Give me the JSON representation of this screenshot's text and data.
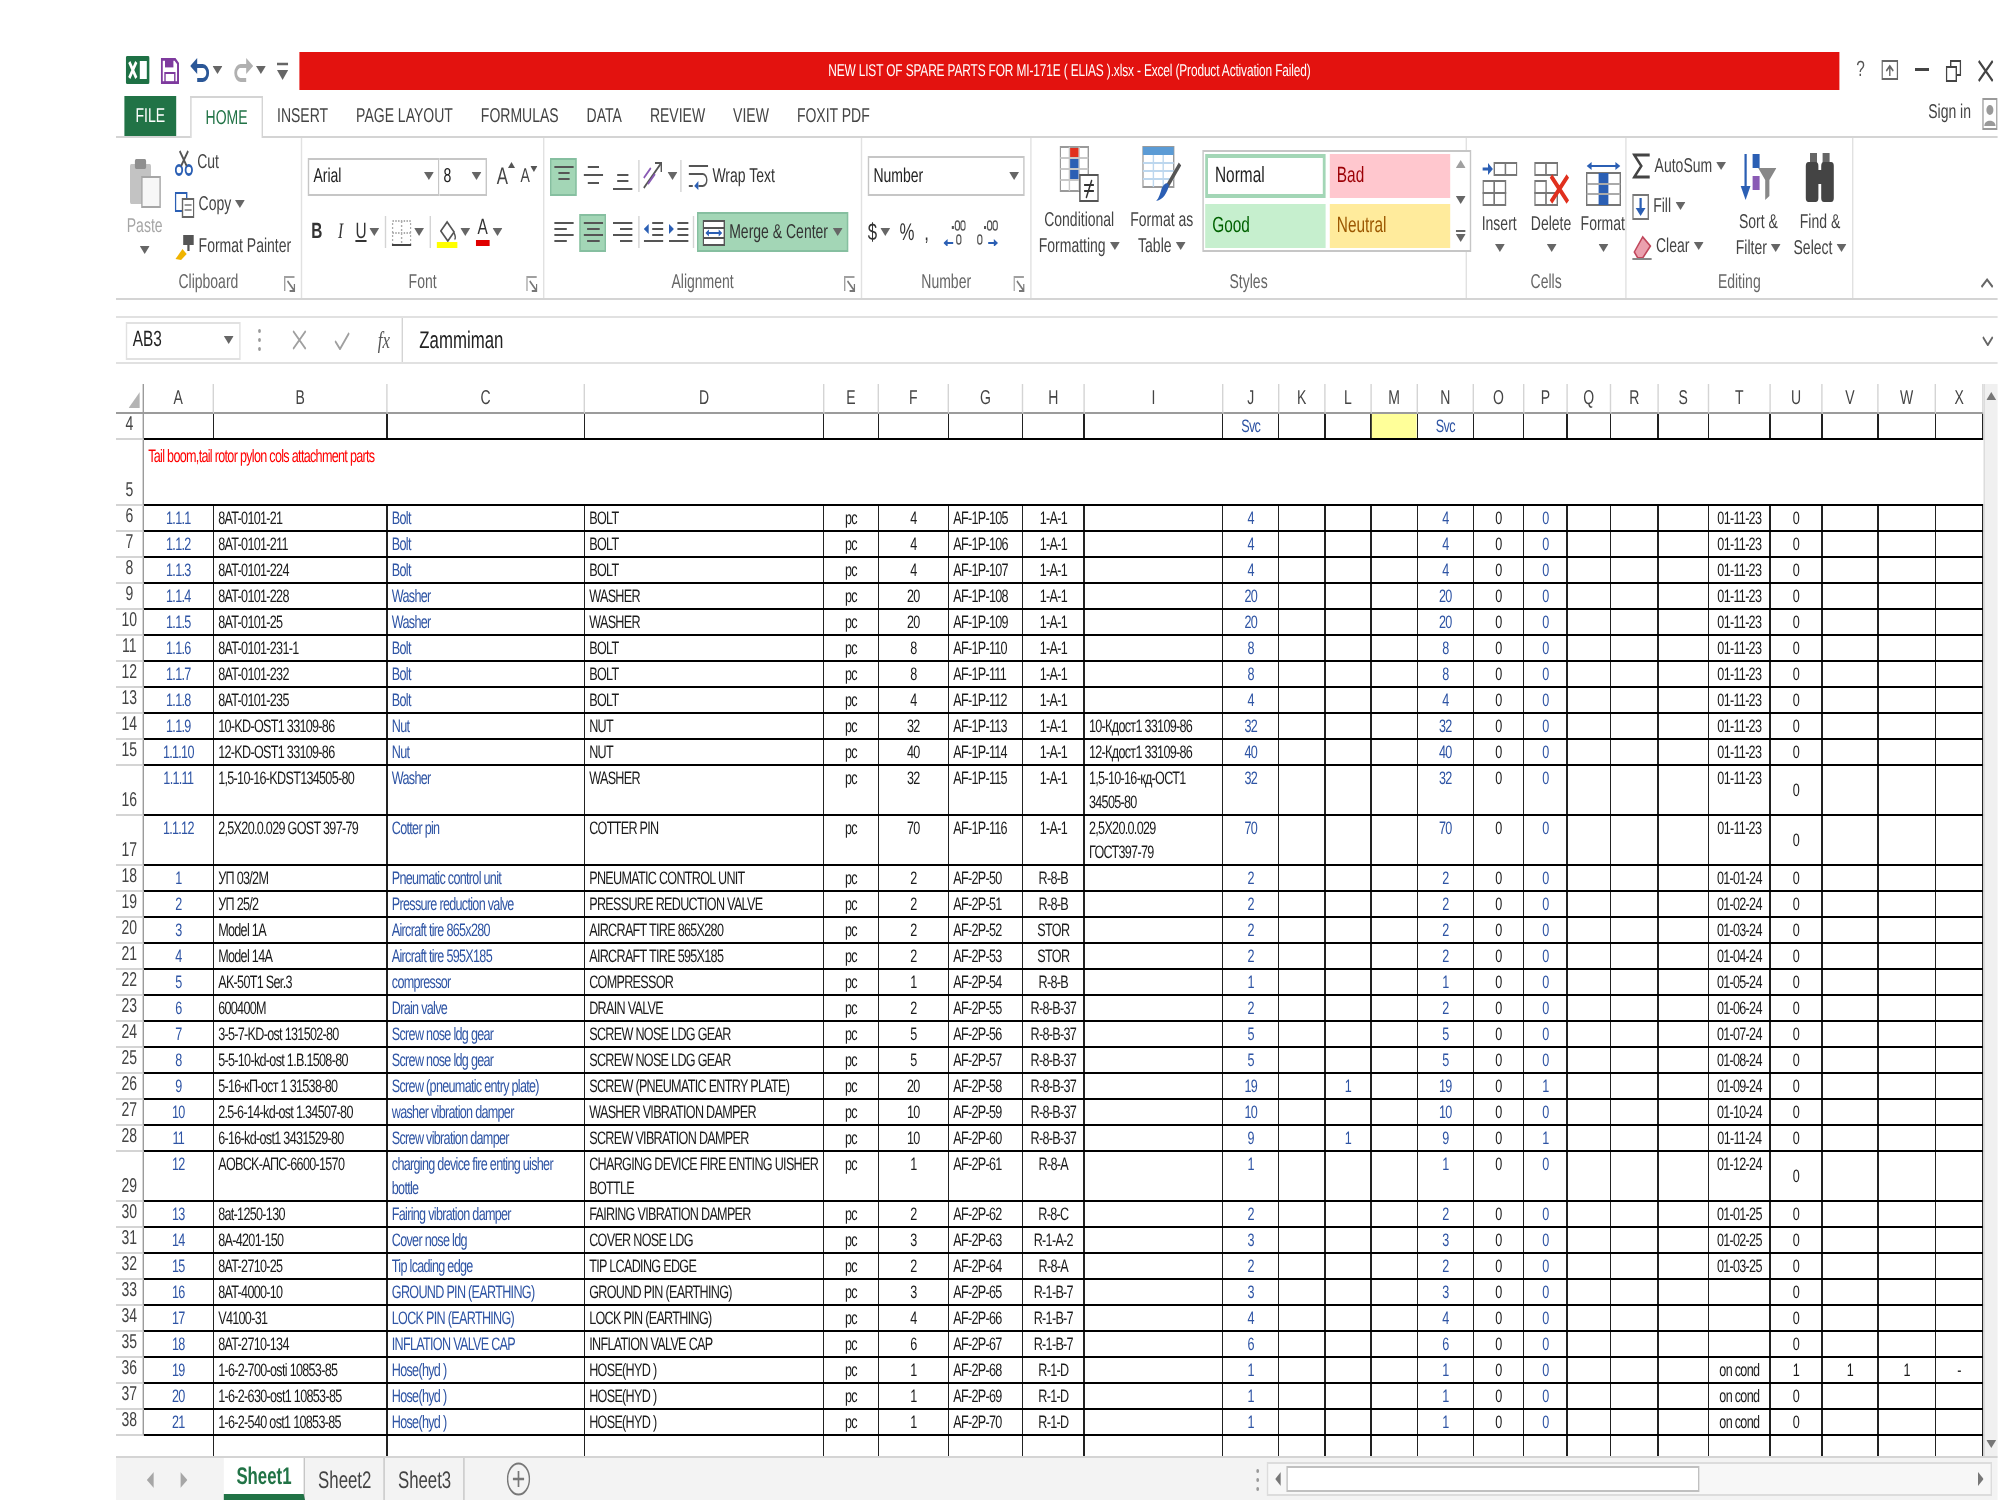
{
  "quick_access": [
    {
      "kind": "save",
      "disabled": false
    },
    {
      "kind": "undo",
      "disabled": false
    },
    {
      "kind": "redo",
      "disabled": true
    }
  ],
  "title_bar": {
    "title": "NEW LIST OF SPARE PARTS FOR MI-171E ( ELIAS ).xlsx - Excel (Product Activation Failed)",
    "help": "?"
  },
  "ribbon_tabs": [
    {
      "label": "FILE",
      "kind": "file",
      "selected": false
    },
    {
      "label": "HOME",
      "kind": "tab",
      "selected": true
    },
    {
      "label": "INSERT",
      "kind": "tab",
      "selected": false
    },
    {
      "label": "PAGE LAYOUT",
      "kind": "tab",
      "selected": false
    },
    {
      "label": "FORMULAS",
      "kind": "tab",
      "selected": false
    },
    {
      "label": "DATA",
      "kind": "tab",
      "selected": false
    },
    {
      "label": "REVIEW",
      "kind": "tab",
      "selected": false
    },
    {
      "label": "VIEW",
      "kind": "tab",
      "selected": false
    },
    {
      "label": "FOXIT PDF",
      "kind": "tab",
      "selected": false
    }
  ],
  "account": {
    "label": "Sign in"
  },
  "ribbon": {
    "clipboard": {
      "label": "Clipboard",
      "paste": {
        "label": "Paste",
        "disabled": true
      },
      "cut": "Cut",
      "copy": "Copy",
      "format_painter": "Format Painter"
    },
    "font": {
      "label": "Font",
      "font_name": "Arial",
      "font_size": "8",
      "grow_font": "A",
      "shrink_font": "A",
      "bold": "B",
      "italic": "I",
      "underline": "U",
      "font_color": "A"
    },
    "alignment": {
      "label": "Alignment",
      "vertical": [
        {
          "kind": "top",
          "selected": true
        },
        {
          "kind": "middle",
          "selected": false
        },
        {
          "kind": "bottom",
          "selected": false
        }
      ],
      "horizontal": [
        {
          "kind": "left",
          "selected": false
        },
        {
          "kind": "center",
          "selected": true
        },
        {
          "kind": "right",
          "selected": false
        }
      ],
      "wrap_text": {
        "label": "Wrap Text",
        "selected": false
      },
      "merge_center": {
        "label": "Merge & Center",
        "selected": true
      }
    },
    "number": {
      "label": "Number",
      "format": "Number",
      "currency": "$",
      "percent": "%",
      "comma": ","
    },
    "styles": {
      "label": "Styles",
      "conditional_formatting": "Conditional Formatting",
      "format_as_table": "Format as Table",
      "gallery": [
        {
          "label": "Normal",
          "kind": "normal",
          "selected": true
        },
        {
          "label": "Bad",
          "kind": "bad",
          "selected": false
        },
        {
          "label": "Good",
          "kind": "good",
          "selected": false
        },
        {
          "label": "Neutral",
          "kind": "neutral",
          "selected": false
        }
      ]
    },
    "cells": {
      "label": "Cells",
      "buttons": [
        {
          "label": "Insert",
          "kind": "insert"
        },
        {
          "label": "Delete",
          "kind": "delete"
        },
        {
          "label": "Format",
          "kind": "format"
        }
      ]
    },
    "editing": {
      "label": "Editing",
      "autosum": "AutoSum",
      "fill": "Fill",
      "clear": "Clear",
      "sort_filter": "Sort & Filter",
      "find_select": "Find & Select"
    }
  },
  "formula_bar": {
    "name_box": "AB3",
    "function_label": "fx",
    "formula": "Zammiman"
  },
  "sheet": {
    "columns": [
      "A",
      "B",
      "C",
      "D",
      "E",
      "F",
      "G",
      "H",
      "I",
      "J",
      "K",
      "L",
      "M",
      "N",
      "O",
      "P",
      "Q",
      "R",
      "S",
      "T",
      "U",
      "V",
      "W",
      "X"
    ],
    "rows": [
      {
        "row": "4",
        "kind": "item",
        "cells": {
          "J": "Svc",
          "N": "Svc"
        },
        "fills": {
          "M": {
            "color": "#ffff99"
          }
        }
      },
      {
        "row": "5",
        "kind": "section",
        "cells": {
          "A": "Tail boom,tail rotor pylon cols attachment parts"
        }
      },
      {
        "row": "6",
        "kind": "item",
        "cells": {
          "A": "1.1.1",
          "B": "8AT-0101-21",
          "C": "Bolt",
          "D": "BOLT",
          "E": "pc",
          "F": "4",
          "G": "AF-1P-105",
          "H": "1-A-1",
          "J": "4",
          "N": "4",
          "O": "0",
          "P": "0",
          "T": "01-11-23",
          "U": "0"
        }
      },
      {
        "row": "7",
        "kind": "item",
        "cells": {
          "A": "1.1.2",
          "B": "8AT-0101-211",
          "C": "Bolt",
          "D": "BOLT",
          "E": "pc",
          "F": "4",
          "G": "AF-1P-106",
          "H": "1-A-1",
          "J": "4",
          "N": "4",
          "O": "0",
          "P": "0",
          "T": "01-11-23",
          "U": "0"
        }
      },
      {
        "row": "8",
        "kind": "item",
        "cells": {
          "A": "1.1.3",
          "B": "8AT-0101-224",
          "C": "Bolt",
          "D": "BOLT",
          "E": "pc",
          "F": "4",
          "G": "AF-1P-107",
          "H": "1-A-1",
          "J": "4",
          "N": "4",
          "O": "0",
          "P": "0",
          "T": "01-11-23",
          "U": "0"
        }
      },
      {
        "row": "9",
        "kind": "item",
        "cells": {
          "A": "1.1.4",
          "B": "8AT-0101-228",
          "C": "Washer",
          "D": "WASHER",
          "E": "pc",
          "F": "20",
          "G": "AF-1P-108",
          "H": "1-A-1",
          "J": "20",
          "N": "20",
          "O": "0",
          "P": "0",
          "T": "01-11-23",
          "U": "0"
        }
      },
      {
        "row": "10",
        "kind": "item",
        "cells": {
          "A": "1.1.5",
          "B": "8AT-0101-25",
          "C": "Washer",
          "D": "WASHER",
          "E": "pc",
          "F": "20",
          "G": "AF-1P-109",
          "H": "1-A-1",
          "J": "20",
          "N": "20",
          "O": "0",
          "P": "0",
          "T": "01-11-23",
          "U": "0"
        }
      },
      {
        "row": "11",
        "kind": "item",
        "cells": {
          "A": "1.1.6",
          "B": "8AT-0101-231-1",
          "C": "Bolt",
          "D": "BOLT",
          "E": "pc",
          "F": "8",
          "G": "AF-1P-110",
          "H": "1-A-1",
          "J": "8",
          "N": "8",
          "O": "0",
          "P": "0",
          "T": "01-11-23",
          "U": "0"
        }
      },
      {
        "row": "12",
        "kind": "item",
        "cells": {
          "A": "1.1.7",
          "B": "8AT-0101-232",
          "C": "Bolt",
          "D": "BOLT",
          "E": "pc",
          "F": "8",
          "G": "AF-1P-111",
          "H": "1-A-1",
          "J": "8",
          "N": "8",
          "O": "0",
          "P": "0",
          "T": "01-11-23",
          "U": "0"
        }
      },
      {
        "row": "13",
        "kind": "item",
        "cells": {
          "A": "1.1.8",
          "B": "8AT-0101-235",
          "C": "Bolt",
          "D": "BOLT",
          "E": "pc",
          "F": "4",
          "G": "AF-1P-112",
          "H": "1-A-1",
          "J": "4",
          "N": "4",
          "O": "0",
          "P": "0",
          "T": "01-11-23",
          "U": "0"
        }
      },
      {
        "row": "14",
        "kind": "item",
        "cells": {
          "A": "1.1.9",
          "B": "10-KD-OST1 33109-86",
          "C": "Nut",
          "D": "NUT",
          "E": "pc",
          "F": "32",
          "G": "AF-1P-113",
          "H": "1-A-1",
          "I": "10-Кдост1 33109-86",
          "J": "32",
          "N": "32",
          "O": "0",
          "P": "0",
          "T": "01-11-23",
          "U": "0"
        }
      },
      {
        "row": "15",
        "kind": "item",
        "cells": {
          "A": "1.1.10",
          "B": "12-KD-OST1 33109-86",
          "C": "Nut",
          "D": "NUT",
          "E": "pc",
          "F": "40",
          "G": "AF-1P-114",
          "H": "1-A-1",
          "I": "12-Кдост1 33109-86",
          "J": "40",
          "N": "40",
          "O": "0",
          "P": "0",
          "T": "01-11-23",
          "U": "0"
        }
      },
      {
        "row": "16",
        "kind": "item",
        "cells": {
          "A": "1.1.11",
          "B": "1,5-10-16-KDST134505-80",
          "C": "Washer",
          "D": "WASHER",
          "E": "pc",
          "F": "32",
          "G": "AF-1P-115",
          "H": "1-A-1",
          "I": "1,5-10-16-кд-ОСТ1 34505-80",
          "J": "32",
          "N": "32",
          "O": "0",
          "P": "0",
          "T": "01-11-23",
          "U": "0"
        }
      },
      {
        "row": "17",
        "kind": "item",
        "cells": {
          "A": "1.1.12",
          "B": "2,5X20.0.029 GOST 397-79",
          "C": "Cotter pin",
          "D": "COTTER PIN",
          "E": "pc",
          "F": "70",
          "G": "AF-1P-116",
          "H": "1-A-1",
          "I": "2,5X20.0.029 ГОСТ397-79",
          "J": "70",
          "N": "70",
          "O": "0",
          "P": "0",
          "T": "01-11-23",
          "U": "0"
        }
      },
      {
        "row": "18",
        "kind": "item",
        "cells": {
          "A": "1",
          "B": "УП 03/2М",
          "C": "Pneumatic control unit",
          "D": "PNEUMATIC CONTROL UNIT",
          "E": "pc",
          "F": "2",
          "G": "AF-2P-50",
          "H": "R-8-B",
          "J": "2",
          "N": "2",
          "O": "0",
          "P": "0",
          "T": "01-01-24",
          "U": "0"
        }
      },
      {
        "row": "19",
        "kind": "item",
        "cells": {
          "A": "2",
          "B": "УП 25/2",
          "C": "Pressure reduction valve",
          "D": "PRESSURE REDUCTION VALVE",
          "E": "pc",
          "F": "2",
          "G": "AF-2P-51",
          "H": "R-8-B",
          "J": "2",
          "N": "2",
          "O": "0",
          "P": "0",
          "T": "01-02-24",
          "U": "0"
        }
      },
      {
        "row": "20",
        "kind": "item",
        "cells": {
          "A": "3",
          "B": "Model 1A",
          "C": "Aircraft tire 865x280",
          "D": "AIRCRAFT TIRE 865X280",
          "E": "pc",
          "F": "2",
          "G": "AF-2P-52",
          "H": "STOR",
          "J": "2",
          "N": "2",
          "O": "0",
          "P": "0",
          "T": "01-03-24",
          "U": "0"
        }
      },
      {
        "row": "21",
        "kind": "item",
        "cells": {
          "A": "4",
          "B": "Model 14A",
          "C": "Aircraft tire 595X185",
          "D": "AIRCRAFT TIRE 595X185",
          "E": "pc",
          "F": "2",
          "G": "AF-2P-53",
          "H": "STOR",
          "J": "2",
          "N": "2",
          "O": "0",
          "P": "0",
          "T": "01-04-24",
          "U": "0"
        }
      },
      {
        "row": "22",
        "kind": "item",
        "cells": {
          "A": "5",
          "B": "AK-50T1 Ser.3",
          "C": "compressor",
          "D": "COMPRESSOR",
          "E": "pc",
          "F": "1",
          "G": "AF-2P-54",
          "H": "R-8-B",
          "J": "1",
          "N": "1",
          "O": "0",
          "P": "0",
          "T": "01-05-24",
          "U": "0"
        }
      },
      {
        "row": "23",
        "kind": "item",
        "cells": {
          "A": "6",
          "B": "600400M",
          "C": "Drain valve",
          "D": "DRAIN VALVE",
          "E": "pc",
          "F": "2",
          "G": "AF-2P-55",
          "H": "R-8-B-37",
          "J": "2",
          "N": "2",
          "O": "0",
          "P": "0",
          "T": "01-06-24",
          "U": "0"
        }
      },
      {
        "row": "24",
        "kind": "item",
        "cells": {
          "A": "7",
          "B": "3-5-7-KD-ost 131502-80",
          "C": "Screw nose ldg gear",
          "D": "SCREW NOSE LDG GEAR",
          "E": "pc",
          "F": "5",
          "G": "AF-2P-56",
          "H": "R-8-B-37",
          "J": "5",
          "N": "5",
          "O": "0",
          "P": "0",
          "T": "01-07-24",
          "U": "0"
        }
      },
      {
        "row": "25",
        "kind": "item",
        "cells": {
          "A": "8",
          "B": "5-5-10-kd-ost 1.B.1508-80",
          "C": "Screw nose ldg gear",
          "D": "SCREW NOSE LDG GEAR",
          "E": "pc",
          "F": "5",
          "G": "AF-2P-57",
          "H": "R-8-B-37",
          "J": "5",
          "N": "5",
          "O": "0",
          "P": "0",
          "T": "01-08-24",
          "U": "0"
        }
      },
      {
        "row": "26",
        "kind": "item",
        "cells": {
          "A": "9",
          "B": "5-16-кП-ост 1 31538-80",
          "C": "Screw (pneumatic entry plate)",
          "D": "SCREW (PNEUMATIC ENTRY PLATE)",
          "E": "pc",
          "F": "20",
          "G": "AF-2P-58",
          "H": "R-8-B-37",
          "J": "19",
          "L": "1",
          "N": "19",
          "O": "0",
          "P": "1",
          "T": "01-09-24",
          "U": "0"
        }
      },
      {
        "row": "27",
        "kind": "item",
        "cells": {
          "A": "10",
          "B": "2.5-6-14-kd-ost 1.34507-80",
          "C": "washer vibration damper",
          "D": "WASHER VIBRATION DAMPER",
          "E": "pc",
          "F": "10",
          "G": "AF-2P-59",
          "H": "R-8-B-37",
          "J": "10",
          "N": "10",
          "O": "0",
          "P": "0",
          "T": "01-10-24",
          "U": "0"
        }
      },
      {
        "row": "28",
        "kind": "item",
        "cells": {
          "A": "11",
          "B": "6-16-kd-ost1 3431529-80",
          "C": "Screw vibration damper",
          "D": "SCREW VIBRATION DAMPER",
          "E": "pc",
          "F": "10",
          "G": "AF-2P-60",
          "H": "R-8-B-37",
          "J": "9",
          "L": "1",
          "N": "9",
          "O": "0",
          "P": "1",
          "T": "01-11-24",
          "U": "0"
        }
      },
      {
        "row": "29",
        "kind": "item",
        "cells": {
          "A": "12",
          "B": "AOBCK-AПC-6600-1570",
          "C": "charging device fire enting uisher bottle",
          "D": "CHARGING DEVICE FIRE ENTING UISHER BOTTLE",
          "E": "pc",
          "F": "1",
          "G": "AF-2P-61",
          "H": "R-8-A",
          "J": "1",
          "N": "1",
          "O": "0",
          "P": "0",
          "T": "01-12-24",
          "U": "0"
        }
      },
      {
        "row": "30",
        "kind": "item",
        "cells": {
          "A": "13",
          "B": "8at-1250-130",
          "C": "Fairing vibration damper",
          "D": "FAIRING VIBRATION DAMPER",
          "E": "pc",
          "F": "2",
          "G": "AF-2P-62",
          "H": "R-8-C",
          "J": "2",
          "N": "2",
          "O": "0",
          "P": "0",
          "T": "01-01-25",
          "U": "0"
        }
      },
      {
        "row": "31",
        "kind": "item",
        "cells": {
          "A": "14",
          "B": "8A-4201-150",
          "C": "Cover nose ldg",
          "D": "COVER NOSE LDG",
          "E": "pc",
          "F": "3",
          "G": "AF-2P-63",
          "H": "R-1-A-2",
          "J": "3",
          "N": "3",
          "O": "0",
          "P": "0",
          "T": "01-02-25",
          "U": "0"
        }
      },
      {
        "row": "32",
        "kind": "item",
        "cells": {
          "A": "15",
          "B": "8AT-2710-25",
          "C": "Tip lcading edge",
          "D": "TIP LCADING EDGE",
          "E": "pc",
          "F": "2",
          "G": "AF-2P-64",
          "H": "R-8-A",
          "J": "2",
          "N": "2",
          "O": "0",
          "P": "0",
          "T": "01-03-25",
          "U": "0"
        }
      },
      {
        "row": "33",
        "kind": "item",
        "cells": {
          "A": "16",
          "B": "8AT-4000-10",
          "C": "GROUND PIN (EARTHING)",
          "D": "GROUND PIN (EARTHING)",
          "E": "pc",
          "F": "3",
          "G": "AF-2P-65",
          "H": "R-1-B-7",
          "J": "3",
          "N": "3",
          "O": "0",
          "P": "0",
          "U": "0"
        }
      },
      {
        "row": "34",
        "kind": "item",
        "cells": {
          "A": "17",
          "B": "V4100-31",
          "C": "LOCK PIN (EARTHING)",
          "D": "LOCK PIN (EARTHING)",
          "E": "pc",
          "F": "4",
          "G": "AF-2P-66",
          "H": "R-1-B-7",
          "J": "4",
          "N": "4",
          "O": "0",
          "P": "0",
          "U": "0"
        }
      },
      {
        "row": "35",
        "kind": "item",
        "cells": {
          "A": "18",
          "B": "8AT-2710-134",
          "C": "INFLATION VALVE CAP",
          "D": "INFLATION VALVE CAP",
          "E": "pc",
          "F": "6",
          "G": "AF-2P-67",
          "H": "R-1-B-7",
          "J": "6",
          "N": "6",
          "O": "0",
          "P": "0",
          "U": "0"
        }
      },
      {
        "row": "36",
        "kind": "item",
        "cells": {
          "A": "19",
          "B": "1-6-2-700-osti 10853-85",
          "C": "Hose(hyd )",
          "D": "HOSE(HYD )",
          "E": "pc",
          "F": "1",
          "G": "AF-2P-68",
          "H": "R-1-D",
          "J": "1",
          "N": "1",
          "O": "0",
          "P": "0",
          "T": "on cond",
          "U": "1",
          "V": "1",
          "W": "1",
          "X": "-"
        }
      },
      {
        "row": "37",
        "kind": "item",
        "cells": {
          "A": "20",
          "B": "1-6-2-630-ost1 10853-85",
          "C": "Hose(hyd )",
          "D": "HOSE(HYD )",
          "E": "pc",
          "F": "1",
          "G": "AF-2P-69",
          "H": "R-1-D",
          "J": "1",
          "N": "1",
          "O": "0",
          "P": "0",
          "T": "on cond",
          "U": "0"
        }
      },
      {
        "row": "38",
        "kind": "item",
        "cells": {
          "A": "21",
          "B": "1-6-2-540 ost1 10853-85",
          "C": "Hose(hyd )",
          "D": "HOSE(HYD )",
          "E": "pc",
          "F": "1",
          "G": "AF-2P-70",
          "H": "R-1-D",
          "J": "1",
          "N": "1",
          "O": "0",
          "P": "0",
          "T": "on cond",
          "U": "0"
        }
      }
    ]
  },
  "sheet_tabs": [
    {
      "label": "Sheet1",
      "selected": true
    },
    {
      "label": "Sheet2",
      "selected": false
    },
    {
      "label": "Sheet3",
      "selected": false
    }
  ]
}
